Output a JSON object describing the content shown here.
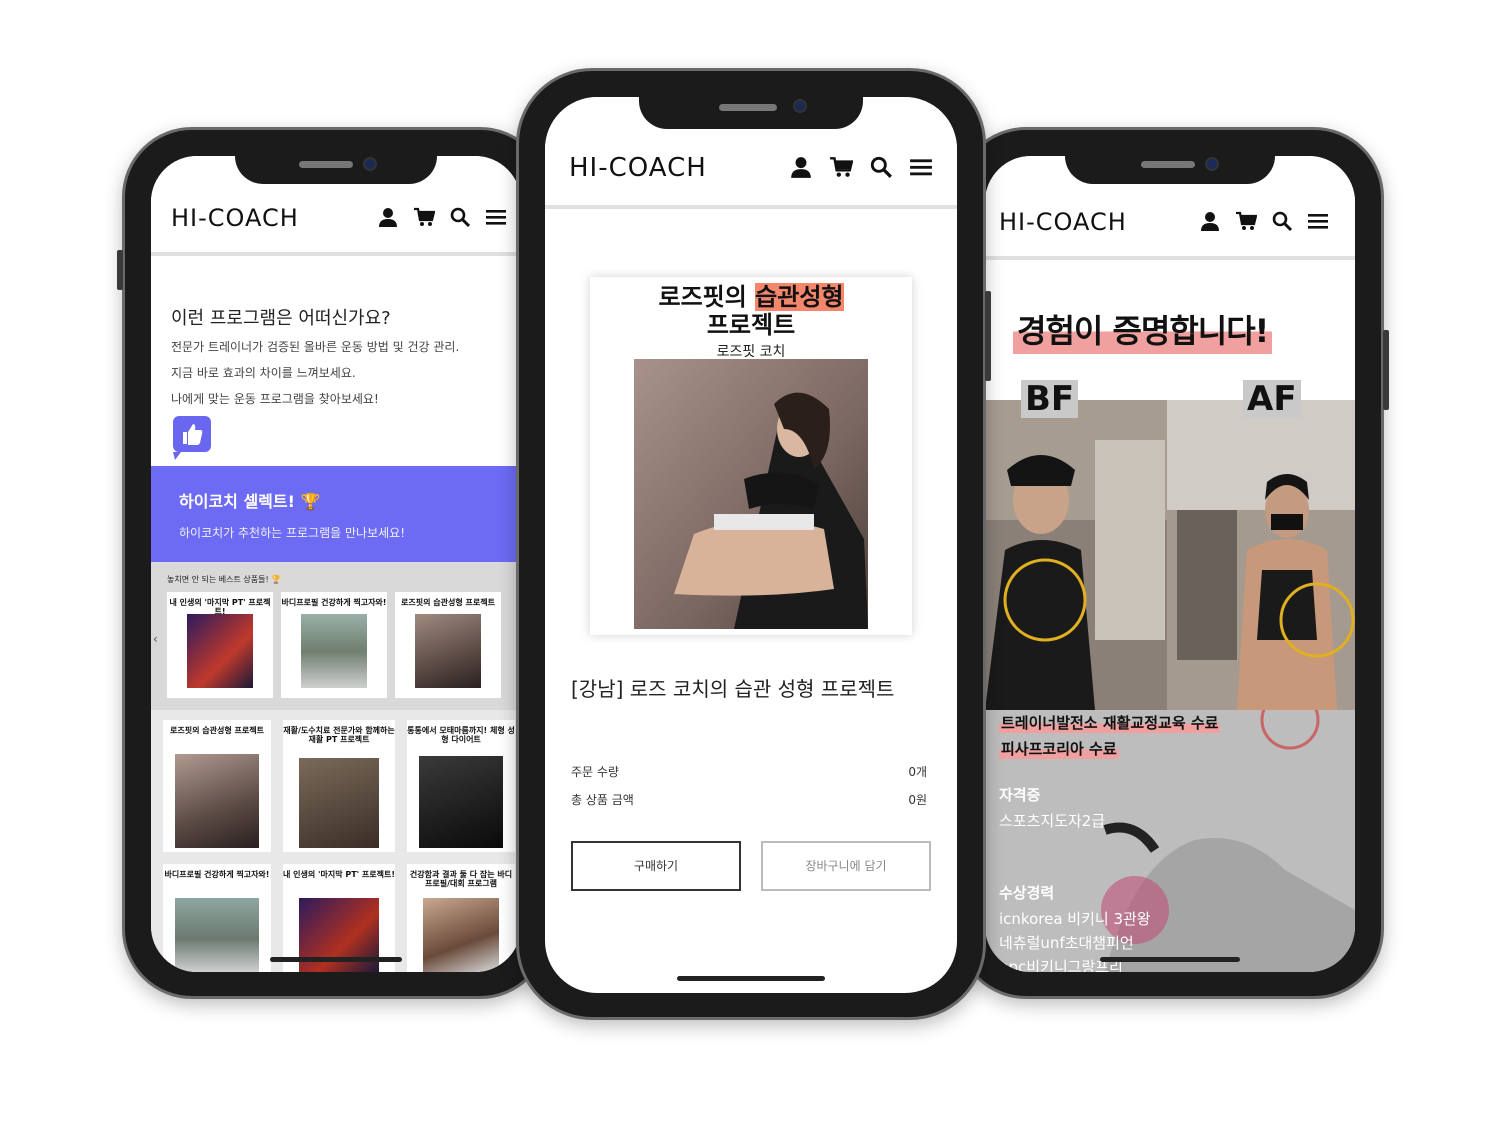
{
  "brand": "HI-COACH",
  "icons": [
    "user-icon",
    "cart-icon",
    "search-icon",
    "menu-icon"
  ],
  "left_phone": {
    "intro_title": "이런 프로그램은 어떠신가요?",
    "intro_lines": [
      "전문가 트레이너가 검증된 올바른 운동 방법 및 건강 관리.",
      "지금 바로 효과의 차이를 느껴보세요.",
      "나에게 맞는 운동 프로그램을 찾아보세요!"
    ],
    "select_title": "하이코치 셀렉트!",
    "select_sub": "하이코치가 추천하는 프로그램을 만나보세요!",
    "best_label": "놓치면 안 되는 베스트 상품들! 🏆",
    "carousel": [
      "내 인생의 '마지막 PT' 프로젝트!",
      "바디프로필 건강하게 찍고자와!",
      "로즈핏의 습관성형 프로젝트"
    ],
    "grid": [
      "로즈핏의 습관성형 프로젝트",
      "재활/도수치료 전문가와 함께하는 재활 PT 프로젝트",
      "통통에서 모태마름까지! 체형 성형 다이어트",
      "바디프로필 건강하게 찍고자와!",
      "내 인생의 '마지막 PT' 프로젝트!",
      "건강함과 결과 둘 다 잡는 바디프로필/대회 프로그램"
    ],
    "colors": {
      "banner": "#6d6bf4"
    }
  },
  "center_phone": {
    "card_headline_1": "로즈핏의",
    "card_headline_hl": "습관성형",
    "card_headline_2": "프로젝트",
    "card_coach": "로즈핏 코치",
    "product_name": "[강남] 로즈 코치의 습관 성형 프로젝트",
    "qty_label": "주문 수량",
    "qty_value": "0개",
    "total_label": "총 상품 금액",
    "total_value": "0원",
    "buy_button": "구매하기",
    "cart_button": "장바구니에 담기"
  },
  "right_phone": {
    "headline": "경험이 증명합니다!",
    "bf_label": "BF",
    "af_label": "AF",
    "certs": [
      "트레이너발전소 재활교정교육 수료",
      "피사프코리아 수료"
    ],
    "license_title": "자격증",
    "license_text": "스포츠지도자2급",
    "award_title": "수상경력",
    "awards": [
      "icnkorea 비키니 3관왕",
      "네츄럴unf초대챔피언",
      "npc비키니그랑프리"
    ]
  }
}
